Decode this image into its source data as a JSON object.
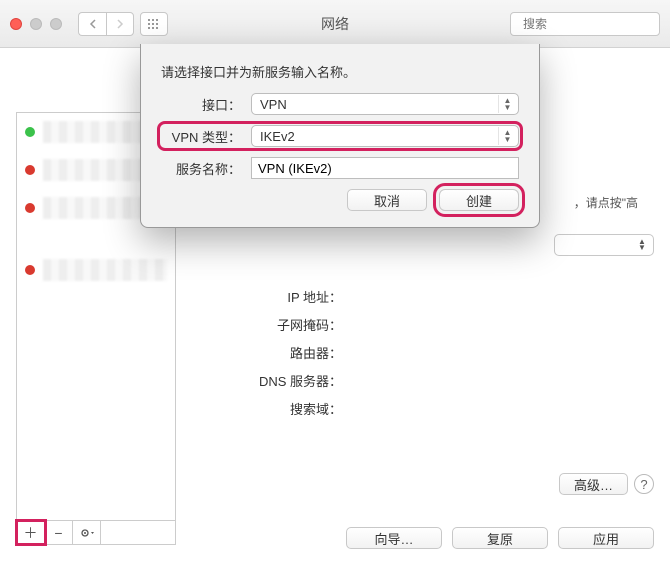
{
  "window": {
    "title": "网络",
    "search_placeholder": "搜索"
  },
  "sheet": {
    "prompt": "请选择接口并为新服务输入名称。",
    "interface_label": "接口：",
    "interface_value": "VPN",
    "vpntype_label": "VPN 类型：",
    "vpntype_value": "IKEv2",
    "servicename_label": "服务名称：",
    "servicename_value": "VPN (IKEv2)",
    "cancel": "取消",
    "create": "创建"
  },
  "sidebar": {
    "items": [
      {
        "status": "green"
      },
      {
        "status": "red"
      },
      {
        "status": "red"
      },
      {
        "status": "red"
      }
    ]
  },
  "detail": {
    "hint_right": "，请点按\"高",
    "rows": {
      "ip": "IP 地址：",
      "subnet": "子网掩码：",
      "router": "路由器：",
      "dns": "DNS 服务器：",
      "search": "搜索域："
    },
    "advanced": "高级…"
  },
  "actions": {
    "wizard": "向导…",
    "revert": "复原",
    "apply": "应用"
  }
}
